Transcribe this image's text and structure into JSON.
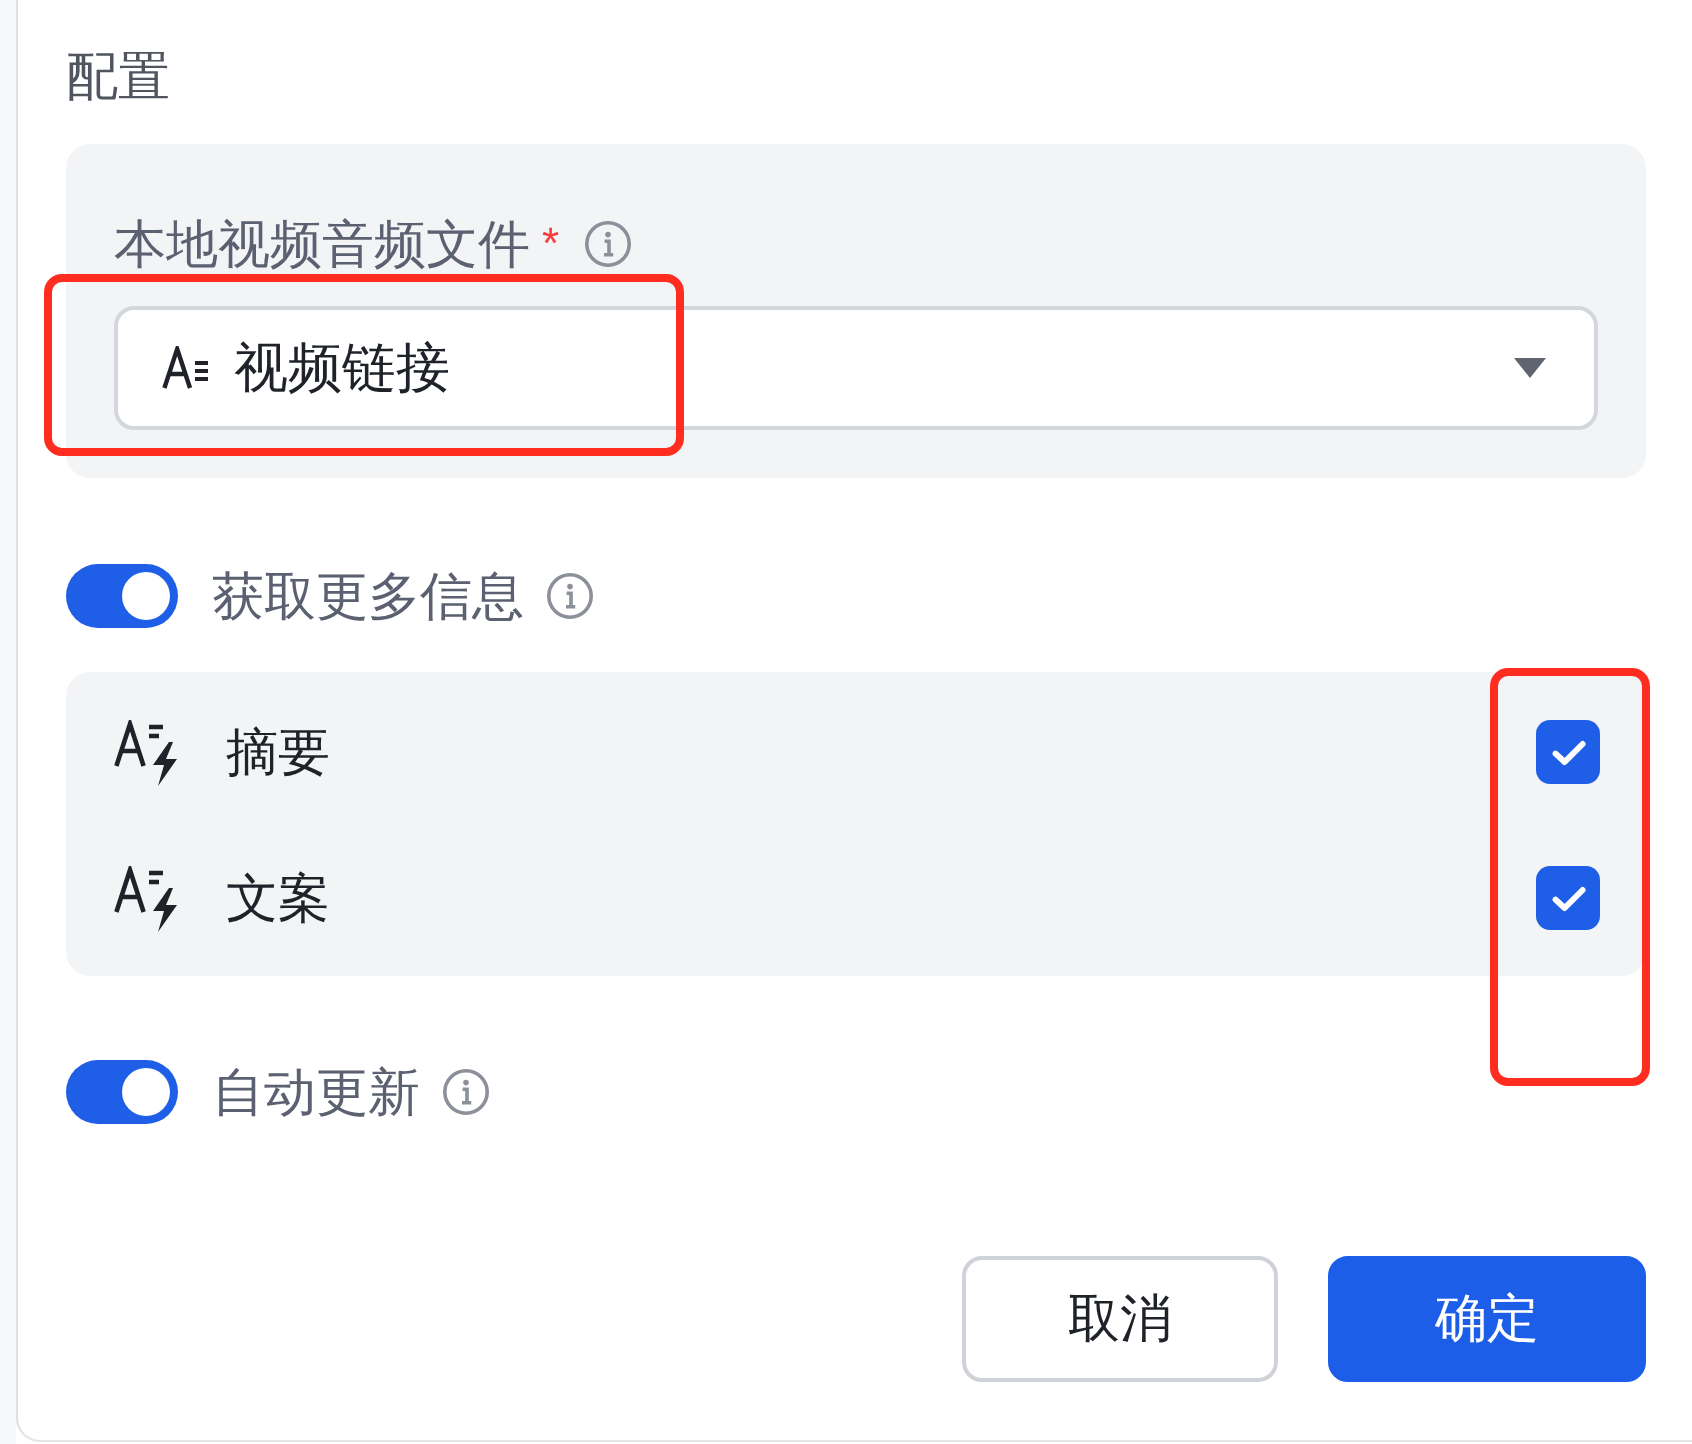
{
  "title": "配置",
  "source": {
    "label": "本地视频音频文件",
    "required_mark": "*",
    "select": {
      "value": "视频链接",
      "highlighted": true
    }
  },
  "more_info": {
    "label": "获取更多信息",
    "on": true,
    "options": [
      {
        "label": "摘要",
        "checked": true
      },
      {
        "label": "文案",
        "checked": true
      }
    ],
    "checkbox_column_highlighted": true
  },
  "auto_update": {
    "label": "自动更新",
    "on": true
  },
  "buttons": [
    {
      "label": "取消",
      "kind": "secondary"
    },
    {
      "label": "确定",
      "kind": "primary"
    }
  ]
}
